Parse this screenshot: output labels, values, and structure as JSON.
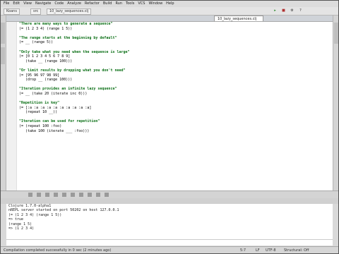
{
  "menu": [
    "File",
    "Edit",
    "View",
    "Navigate",
    "Code",
    "Analyze",
    "Refactor",
    "Build",
    "Run",
    "Tools",
    "VCS",
    "Window",
    "Help"
  ],
  "toolbar": {
    "crumb1": "Koans",
    "crumb2": "src",
    "crumb3": "10_lazy_sequences.clj",
    "run_icons": [
      "▸",
      "■",
      "⚙",
      "?"
    ]
  },
  "tab": {
    "label": "10_lazy_sequences.clj"
  },
  "code_lines": [
    {
      "kind": "str",
      "text": "\"There are many ways to generate a sequence\""
    },
    {
      "kind": "code",
      "text": "(= (1 2 3 4) (range 1 5))"
    },
    {
      "kind": "blank",
      "text": ""
    },
    {
      "kind": "str",
      "text": "\"The range starts at the beginning by default\""
    },
    {
      "kind": "code",
      "text": "(= __ (range 5))"
    },
    {
      "kind": "blank",
      "text": ""
    },
    {
      "kind": "str",
      "text": "\"Only take what you need when the sequence is large\""
    },
    {
      "kind": "code",
      "text": "(= [0 1 2 3 4 5 6 7 8 9]"
    },
    {
      "kind": "code",
      "text": "   (take __ (range 100)))"
    },
    {
      "kind": "blank",
      "text": ""
    },
    {
      "kind": "str",
      "text": "\"Or limit results by dropping what you don't need\""
    },
    {
      "kind": "code",
      "text": "(= [95 96 97 98 99]"
    },
    {
      "kind": "code",
      "text": "   (drop __ (range 100)))"
    },
    {
      "kind": "blank",
      "text": ""
    },
    {
      "kind": "str",
      "text": "\"Iteration provides an infinite lazy sequence\""
    },
    {
      "kind": "code",
      "text": "(= __ (take 20 (iterate inc 0)))"
    },
    {
      "kind": "blank",
      "text": ""
    },
    {
      "kind": "str",
      "text": "\"Repetition is key\""
    },
    {
      "kind": "code",
      "text": "(= [:a :a :a :a :a :a :a :a :a :a]"
    },
    {
      "kind": "code",
      "text": "   (repeat 10 __))"
    },
    {
      "kind": "blank",
      "text": ""
    },
    {
      "kind": "str",
      "text": "\"Iteration can be used for repetition\""
    },
    {
      "kind": "code",
      "text": "(= (repeat 100 :foo)"
    },
    {
      "kind": "code",
      "text": "   (take 100 (iterate ___ :foo)))"
    }
  ],
  "repl": {
    "title": "Clojure 1.7.0-alpha1",
    "lines": [
      "Clojure 1.7.0-alpha1",
      "nREPL server started on port 50202 on host 127.0.0.1",
      "(= (1 2 3 4) (range 1 5))",
      "=> true",
      "(range 1 5)",
      "=> (1 2 3 4)"
    ]
  },
  "status": {
    "message": "Compilation completed successfully in 0 sec (2 minutes ago)",
    "position": "5:7",
    "line_sep": "LF",
    "encoding": "UTF-8",
    "mode": "Structural: Off"
  }
}
